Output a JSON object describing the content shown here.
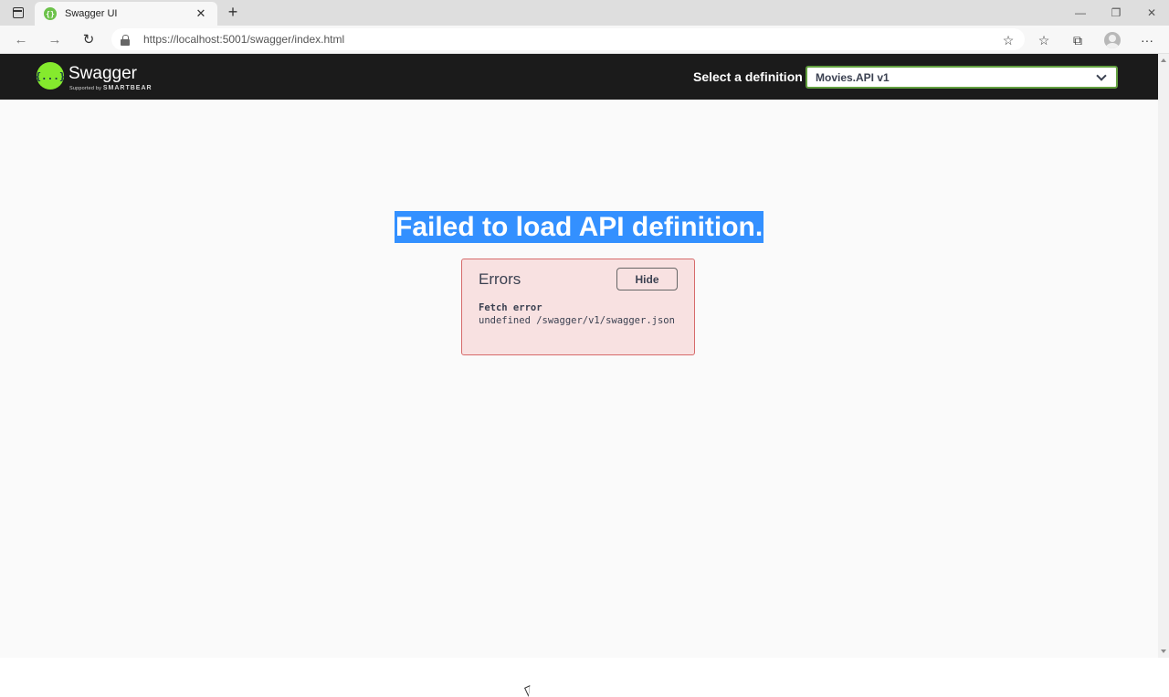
{
  "browser": {
    "tab_title": "Swagger UI",
    "tab_close": "✕",
    "new_tab": "+",
    "url": "https://localhost:5001/swagger/index.html",
    "window_controls": {
      "minimize": "—",
      "maximize": "❐",
      "close": "✕"
    },
    "nav": {
      "back": "←",
      "forward": "→",
      "reload": "↻"
    },
    "toolbar": {
      "favorites_add": "☆",
      "favorites": "☆",
      "collections": "⧉",
      "menu": "···"
    },
    "icons": [
      "sidebar-toggle-icon",
      "swagger-favicon",
      "lock-icon",
      "star-plus-icon",
      "favorites-icon",
      "collections-icon",
      "profile-icon",
      "more-icon"
    ]
  },
  "swagger": {
    "logo_symbol": "{...}",
    "brand": "Swagger",
    "tagline_prefix": "Supported by",
    "tagline_brand": "SMARTBEAR",
    "select_label": "Select a definition",
    "selected_definition": "Movies.API v1",
    "colors": {
      "logo": "#85ea2d",
      "header_bg": "#1b1b1b",
      "select_border": "#62a03f"
    }
  },
  "main": {
    "error_title": "Failed to load API definition.",
    "errors_heading": "Errors",
    "hide_label": "Hide",
    "error_type": "Fetch error",
    "error_message": "undefined /swagger/v1/swagger.json",
    "colors": {
      "selection": "#3390ff",
      "error_bg": "#f8e1e1",
      "error_border": "#d66a6a"
    }
  }
}
